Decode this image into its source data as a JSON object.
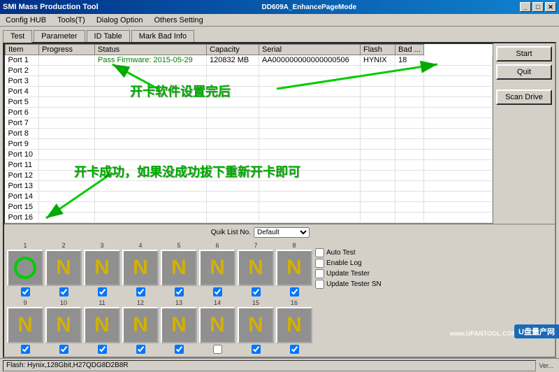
{
  "titleBar": {
    "title": "SMI Mass Production Tool",
    "rightTitle": "DD609A_EnhancePageMode",
    "minimize": "_",
    "maximize": "□",
    "close": "✕"
  },
  "menuBar": {
    "items": [
      "Config HUB",
      "Tools(T)",
      "Dialog Option",
      "Others Setting"
    ]
  },
  "tabs": {
    "items": [
      "Test",
      "Parameter",
      "ID Table",
      "Mark Bad Info"
    ],
    "active": 0
  },
  "table": {
    "headers": [
      "Item",
      "Progress",
      "Status",
      "Capacity",
      "Serial",
      "Flash",
      "Bad ..."
    ],
    "rows": [
      [
        "Port 1",
        "",
        "Pass  Firmware: 2015-05-29",
        "120832 MB",
        "AA000000000000000506",
        "HYNIX",
        "18",
        ""
      ],
      [
        "Port 2",
        "",
        "",
        "",
        "",
        "",
        "",
        ""
      ],
      [
        "Port 3",
        "",
        "",
        "",
        "",
        "",
        "",
        ""
      ],
      [
        "Port 4",
        "",
        "",
        "",
        "",
        "",
        "",
        ""
      ],
      [
        "Port 5",
        "",
        "",
        "",
        "",
        "",
        "",
        ""
      ],
      [
        "Port 6",
        "",
        "",
        "",
        "",
        "",
        "",
        ""
      ],
      [
        "Port 7",
        "",
        "",
        "",
        "",
        "",
        "",
        ""
      ],
      [
        "Port 8",
        "",
        "",
        "",
        "",
        "",
        "",
        ""
      ],
      [
        "Port 9",
        "",
        "",
        "",
        "",
        "",
        "",
        ""
      ],
      [
        "Port 10",
        "",
        "",
        "",
        "",
        "",
        "",
        ""
      ],
      [
        "Port 11",
        "",
        "",
        "",
        "",
        "",
        "",
        ""
      ],
      [
        "Port 12",
        "",
        "",
        "",
        "",
        "",
        "",
        ""
      ],
      [
        "Port 13",
        "",
        "",
        "",
        "",
        "",
        "",
        ""
      ],
      [
        "Port 14",
        "",
        "",
        "",
        "",
        "",
        "",
        ""
      ],
      [
        "Port 15",
        "",
        "",
        "",
        "",
        "",
        "",
        ""
      ],
      [
        "Port 16",
        "",
        "",
        "",
        "",
        "",
        "",
        ""
      ]
    ]
  },
  "rightButtons": {
    "start": "Start",
    "quit": "Quit",
    "scanDrive": "Scan Drive"
  },
  "quik": {
    "label": "Quik List No.",
    "value": "Default"
  },
  "portGrid": {
    "row1": [
      {
        "num": "1",
        "type": "O",
        "checked": true
      },
      {
        "num": "2",
        "type": "N",
        "checked": true
      },
      {
        "num": "3",
        "type": "N",
        "checked": true
      },
      {
        "num": "4",
        "type": "N",
        "checked": true
      },
      {
        "num": "5",
        "type": "N",
        "checked": true
      },
      {
        "num": "6",
        "type": "N",
        "checked": true
      },
      {
        "num": "7",
        "type": "N",
        "checked": true
      },
      {
        "num": "8",
        "type": "N",
        "checked": true
      }
    ],
    "row2": [
      {
        "num": "9",
        "type": "N",
        "checked": true
      },
      {
        "num": "10",
        "type": "N",
        "checked": true
      },
      {
        "num": "11",
        "type": "N",
        "checked": true
      },
      {
        "num": "12",
        "type": "N",
        "checked": true
      },
      {
        "num": "13",
        "type": "N",
        "checked": true
      },
      {
        "num": "14",
        "type": "N",
        "checked": false
      },
      {
        "num": "15",
        "type": "N",
        "checked": true
      },
      {
        "num": "16",
        "type": "N",
        "checked": true
      }
    ]
  },
  "checkboxOptions": {
    "autoTest": {
      "label": "Auto Test",
      "checked": false
    },
    "enableLog": {
      "label": "Enable Log",
      "checked": false
    },
    "updateTester": {
      "label": "Update Tester",
      "checked": false
    },
    "updateTesterSN": {
      "label": "Update Tester SN",
      "checked": false
    }
  },
  "statusBar": {
    "flashInfo": "Flash: Hynix,128Gbit,H27QDG8D2B8R",
    "version": "Ver..."
  },
  "annotations": {
    "text1": "开卡软件设置完后",
    "text2": "开卡成功，如果没成功拔下重新开卡即可"
  },
  "watermark": {
    "text": "www.UPANTOOL.COM",
    "logo": "U盘量产网"
  }
}
